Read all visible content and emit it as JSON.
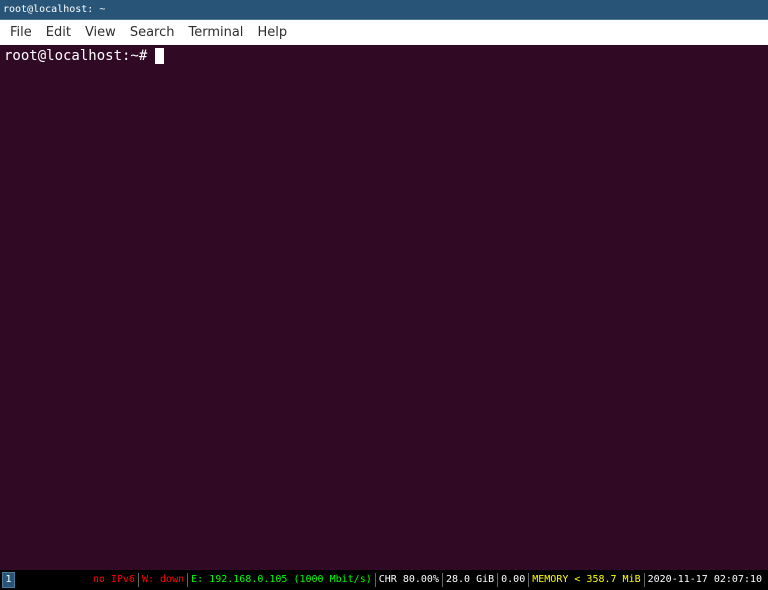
{
  "window": {
    "title": "root@localhost: ~"
  },
  "menubar": {
    "items": [
      "File",
      "Edit",
      "View",
      "Search",
      "Terminal",
      "Help"
    ]
  },
  "terminal": {
    "prompt": "root@localhost:~#",
    "background": "#300a24",
    "foreground": "#ffffff"
  },
  "statusbar": {
    "workspace": "1",
    "blocks": [
      {
        "text": "no IPv6",
        "color": "#ff0000"
      },
      {
        "text": "W: down",
        "color": "#ff0000"
      },
      {
        "text": "E: 192.168.0.105 (1000 Mbit/s)",
        "color": "#00ff00"
      },
      {
        "text": "CHR 80.00%",
        "color": "#ffffff"
      },
      {
        "text": "28.0 GiB",
        "color": "#ffffff"
      },
      {
        "text": "0.00",
        "color": "#ffffff"
      },
      {
        "text": "MEMORY < 358.7 MiB",
        "color": "#ffff00"
      },
      {
        "text": "2020-11-17 02:07:10",
        "color": "#ffffff"
      }
    ]
  },
  "colors": {
    "titlebar": "#285577",
    "menubar": "#ffffff",
    "statusbar": "#000000"
  }
}
